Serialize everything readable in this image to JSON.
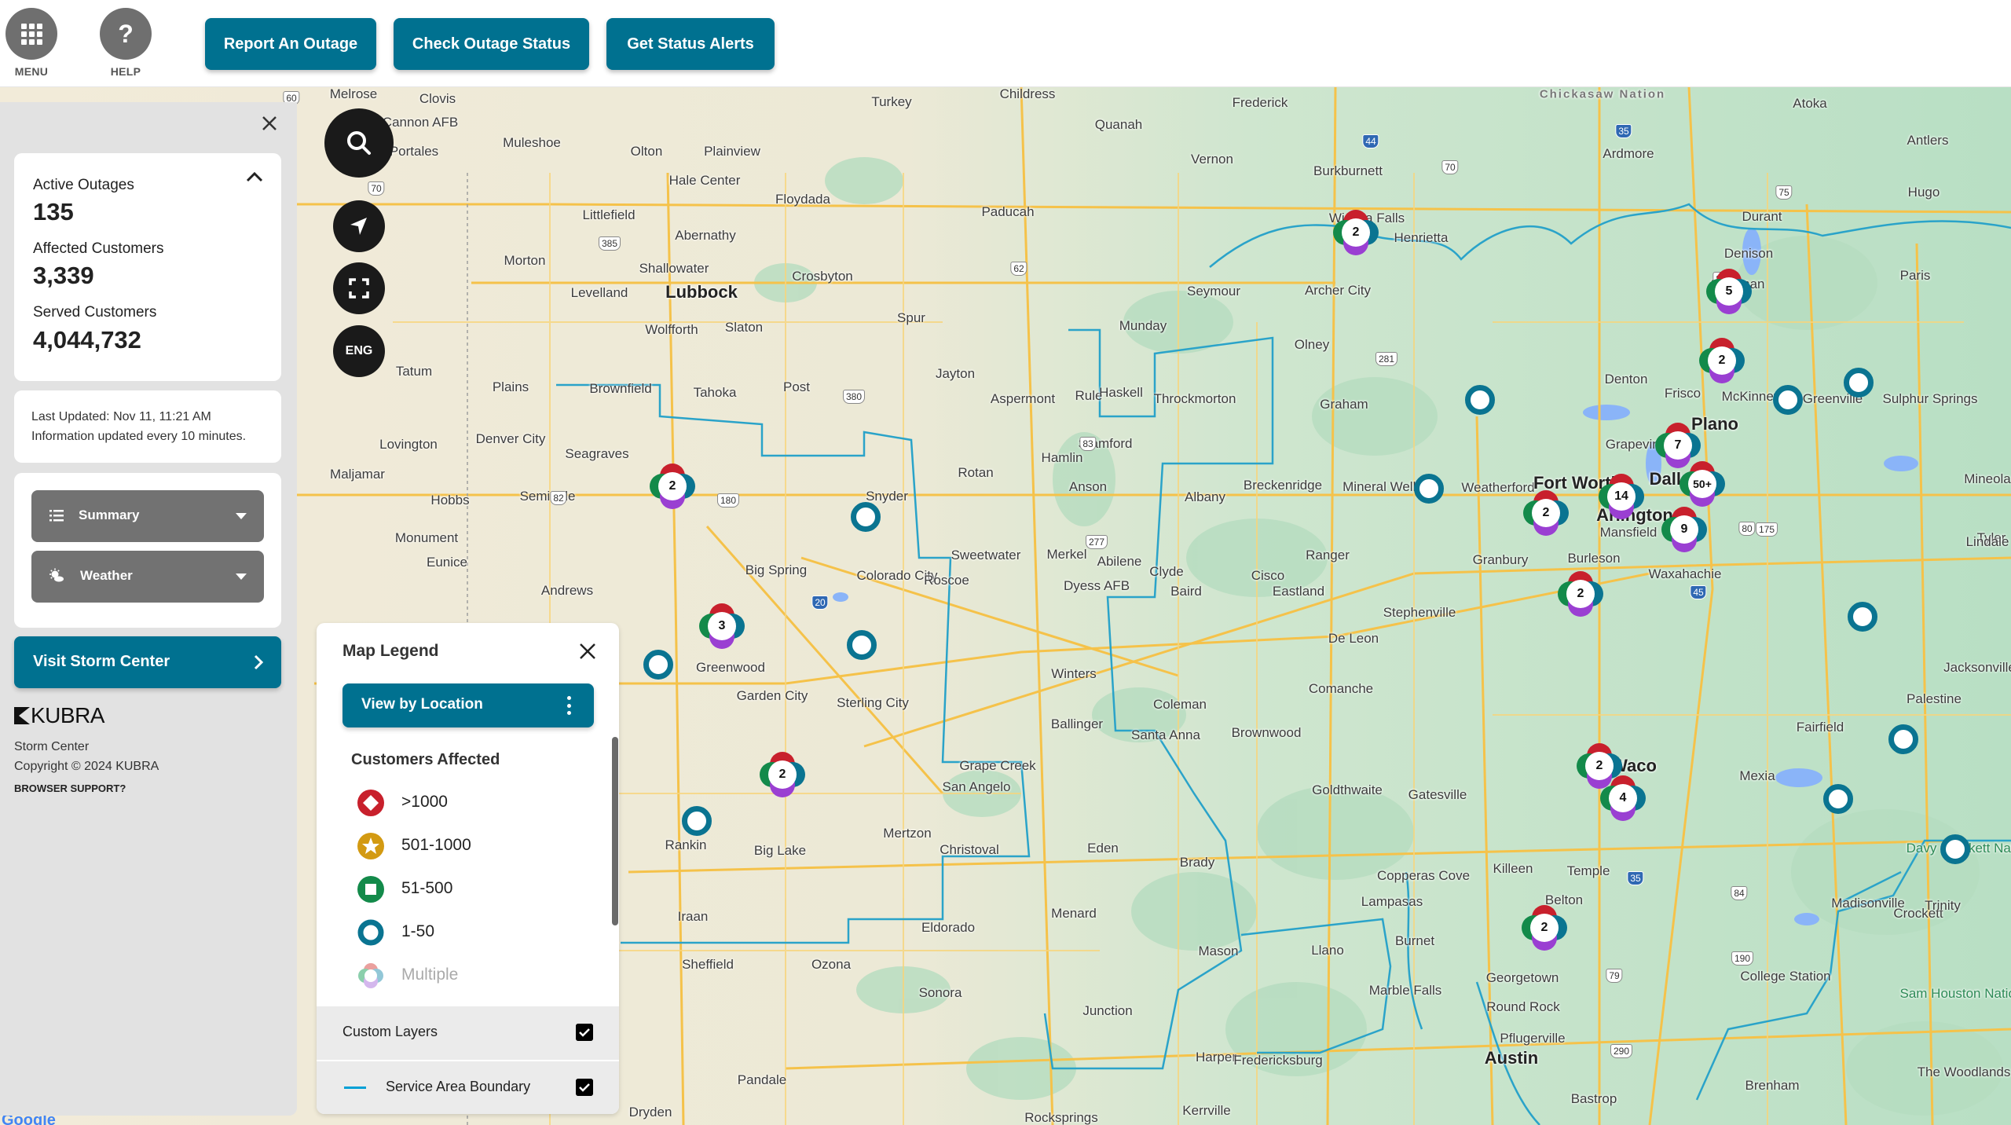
{
  "header": {
    "menu_label": "MENU",
    "help_label": "HELP",
    "buttons": [
      "Report An Outage",
      "Check Outage Status",
      "Get Status Alerts"
    ]
  },
  "colors": {
    "brand": "#007190",
    "outage_gt1000": "#c8202c",
    "outage_501_1000": "#d39a12",
    "outage_51_500": "#138a4a",
    "outage_1_50": "#0a7491",
    "multiple_purple": "#9a3fd2",
    "service_boundary": "#00a0d6"
  },
  "sidebar": {
    "stats": {
      "active_outages_label": "Active Outages",
      "active_outages_value": "135",
      "affected_customers_label": "Affected Customers",
      "affected_customers_value": "3,339",
      "served_customers_label": "Served Customers",
      "served_customers_value": "4,044,732"
    },
    "update": {
      "last_updated": "Last Updated:  Nov 11, 11:21 AM",
      "frequency": "Information updated every 10 minutes."
    },
    "dropdowns": [
      {
        "label": "Summary",
        "icon": "list-icon"
      },
      {
        "label": "Weather",
        "icon": "weather-icon"
      }
    ],
    "visit_button": "Visit Storm Center",
    "footer": {
      "logo": "KUBRA",
      "product": "Storm Center",
      "copyright": "Copyright © 2024 KUBRA",
      "browser_support": "BROWSER SUPPORT?"
    }
  },
  "map_controls": {
    "search": "search-icon",
    "locate": "locate-arrow-icon",
    "fullscreen": "fullscreen-icon",
    "language": "ENG"
  },
  "legend": {
    "title": "Map Legend",
    "view_button": "View by Location",
    "section_title": "Customers Affected",
    "items": [
      {
        "label": ">1000",
        "icon": "diamond-red-icon"
      },
      {
        "label": "501-1000",
        "icon": "star-gold-icon"
      },
      {
        "label": "51-500",
        "icon": "square-green-icon"
      },
      {
        "label": "1-50",
        "icon": "ring-blue-icon"
      },
      {
        "label": "Multiple",
        "icon": "multi-petal-icon"
      }
    ],
    "custom_layers_label": "Custom Layers",
    "custom_layers_checked": true,
    "service_area_label": "Service Area Boundary",
    "service_area_checked": true
  },
  "map": {
    "attribution": "Google",
    "clusters": [
      {
        "count": "2",
        "near": "Wichita Falls"
      },
      {
        "count": "5",
        "near": "Sherman"
      },
      {
        "count": "2",
        "near": "McKinney"
      },
      {
        "count": "7",
        "near": "Plano"
      },
      {
        "count": "14",
        "near": "Fort Worth"
      },
      {
        "count": "50+",
        "near": "Dallas"
      },
      {
        "count": "9",
        "near": "Dallas South"
      },
      {
        "count": "2",
        "near": "Weatherford"
      },
      {
        "count": "2",
        "near": "Burleson"
      },
      {
        "count": "2",
        "near": "Waco"
      },
      {
        "count": "4",
        "near": "Waco South"
      },
      {
        "count": "2",
        "near": "Belton"
      },
      {
        "count": "2",
        "near": "Lamesa"
      },
      {
        "count": "3",
        "near": "Stanton"
      },
      {
        "count": "2",
        "near": "Garden City"
      }
    ],
    "cities": [
      "Melrose",
      "Clovis",
      "Cannon AFB",
      "Portales",
      "Muleshoe",
      "Olton",
      "Plainview",
      "Hale Center",
      "Floydada",
      "Littlefield",
      "Abernathy",
      "Morton",
      "Shallowater",
      "Crosbyton",
      "Levelland",
      "Lubbock",
      "Wolfforth",
      "Slaton",
      "Spur",
      "Tatum",
      "Plains",
      "Brownfield",
      "Tahoka",
      "Post",
      "Lovington",
      "Denver City",
      "Seagraves",
      "Maljamar",
      "Seminole",
      "Hobbs",
      "Monument",
      "Eunice",
      "Andrews",
      "Snyder",
      "Big Spring",
      "Greenwood",
      "Garden City",
      "Sterling City",
      "Colorado City",
      "Roscoe",
      "Sweetwater",
      "Rankin",
      "Big Lake",
      "Mertzon",
      "San Angelo",
      "Grape Creek",
      "Christoval",
      "Eldorado",
      "Iraan",
      "Sheffield",
      "Ozona",
      "Sonora",
      "Pandale",
      "Dryden",
      "Childress",
      "Turkey",
      "Quanah",
      "Paducah",
      "Vernon",
      "Frederick",
      "Burkburnett",
      "Wichita Falls",
      "Henrietta",
      "Seymour",
      "Archer City",
      "Munday",
      "Olney",
      "Jayton",
      "Aspermont",
      "Rule",
      "Haskell",
      "Throckmorton",
      "Graham",
      "Stamford",
      "Hamlin",
      "Rotan",
      "Anson",
      "Albany",
      "Breckenridge",
      "Mineral Wells",
      "Weatherford",
      "Merkel",
      "Abilene",
      "Clyde",
      "Dyess AFB",
      "Baird",
      "Cisco",
      "Eastland",
      "Ranger",
      "Stephenville",
      "De Leon",
      "Winters",
      "Coleman",
      "Ballinger",
      "Santa Anna",
      "Brownwood",
      "Comanche",
      "Goldthwaite",
      "Gatesville",
      "Eden",
      "Brady",
      "Menard",
      "Mason",
      "Llano",
      "Junction",
      "Harper",
      "Fredericksburg",
      "Kerrville",
      "Rocksprings",
      "Marble Falls",
      "Burnet",
      "Lampasas",
      "Copperas Cove",
      "Killeen",
      "Temple",
      "Belton",
      "Georgetown",
      "Round Rock",
      "Pflugerville",
      "Austin",
      "Bastrop",
      "Ardmore",
      "Atoka",
      "Antlers",
      "Hugo",
      "Durant",
      "Denison",
      "Sherman",
      "Paris",
      "Denton",
      "Frisco",
      "McKinney",
      "Greenville",
      "Sulphur Springs",
      "Plano",
      "Grapevine",
      "Fort Worth",
      "Dallas",
      "Arlington",
      "Mansfield",
      "Burleson",
      "Granbury",
      "Waxahachie",
      "Waco",
      "Mexia",
      "Fairfield",
      "Palestine",
      "Crockett",
      "Madisonville",
      "Trinity",
      "College Station",
      "Brenham",
      "Tyler",
      "Jacksonville",
      "Mineola",
      "Lindale",
      "Sam Houston National Forest",
      "The Woodlands",
      "Davy Crockett National Forest",
      "Chickasaw Nation"
    ]
  }
}
